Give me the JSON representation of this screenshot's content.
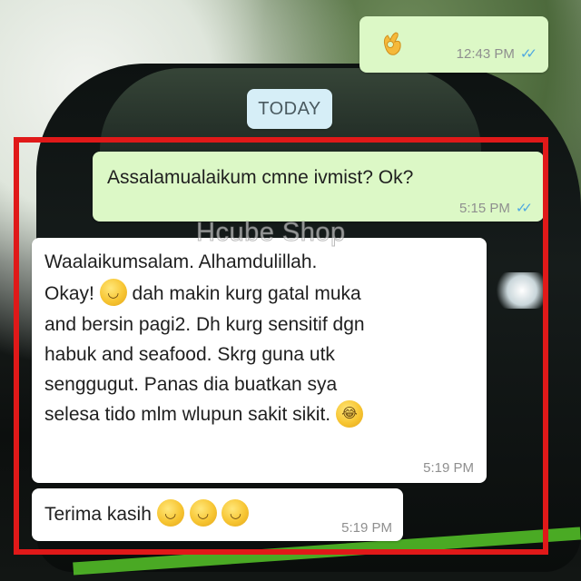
{
  "watermark": "Hcube Shop",
  "date_divider": "TODAY",
  "messages": [
    {
      "direction": "outgoing",
      "emoji": "ok-hand",
      "time": "12:43 PM",
      "read": true
    },
    {
      "direction": "outgoing",
      "text": "Assalamualaikum cmne ivmist? Ok?",
      "time": "5:15 PM",
      "read": true
    },
    {
      "direction": "incoming",
      "lines": [
        "Waalaikumsalam. Alhamdulillah.",
        "Okay!",
        "dah makin kurg gatal muka",
        "and bersin pagi2. Dh kurg sensitif dgn",
        "habuk and seafood. Skrg guna utk",
        "senggugut. Panas dia buatkan sya",
        "selesa tido mlm wlupun sakit sikit."
      ],
      "emojis": [
        "smiling-face",
        "tears-of-joy"
      ],
      "time": "5:19 PM"
    },
    {
      "direction": "incoming",
      "text": "Terima kasih",
      "emojis": [
        "smiling-face",
        "smiling-face",
        "smiling-face"
      ],
      "time": "5:19 PM"
    }
  ],
  "colors": {
    "outgoing_bubble": "#dcf8c6",
    "incoming_bubble": "#ffffff",
    "read_ticks": "#4fa8e0",
    "highlight_frame": "#e01919",
    "date_pill": "#d6eef7"
  }
}
